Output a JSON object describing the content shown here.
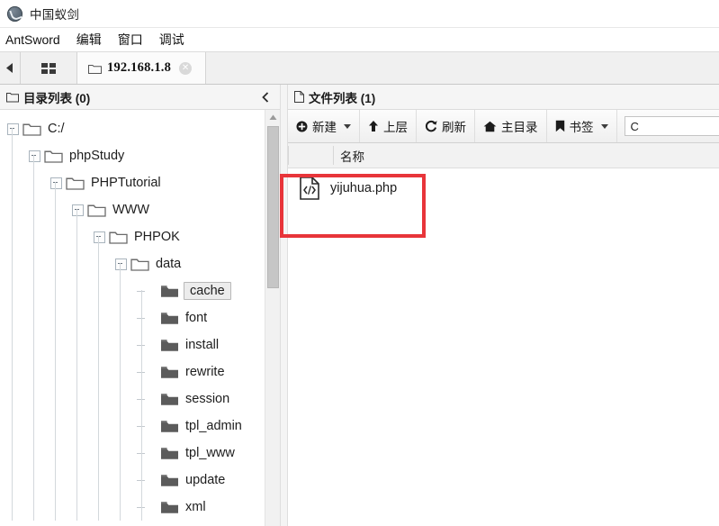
{
  "window": {
    "title": "中国蚁剑",
    "logo_icon": "antsword-logo-icon"
  },
  "menubar": {
    "items": [
      {
        "label": "AntSword"
      },
      {
        "label": "编辑"
      },
      {
        "label": "窗口"
      },
      {
        "label": "调试"
      }
    ]
  },
  "tabbar": {
    "nav_back_icon": "chevron-left-icon",
    "grid_icon": "grid-view-icon",
    "tabs": [
      {
        "label": "192.168.1.8",
        "icon": "folder-icon",
        "close_icon": "close-circle-icon",
        "active": true
      }
    ]
  },
  "left_panel": {
    "header": {
      "icon": "folder-outline-icon",
      "title": "目录列表 (0)",
      "collapse_icon": "chevron-left-icon"
    },
    "tree": [
      {
        "label": "C:/",
        "depth": 0,
        "expanded": true,
        "selected": false,
        "icon": "folder-open-icon"
      },
      {
        "label": "phpStudy",
        "depth": 1,
        "expanded": true,
        "selected": false,
        "icon": "folder-open-icon"
      },
      {
        "label": "PHPTutorial",
        "depth": 2,
        "expanded": true,
        "selected": false,
        "icon": "folder-open-icon"
      },
      {
        "label": "WWW",
        "depth": 3,
        "expanded": true,
        "selected": false,
        "icon": "folder-open-icon"
      },
      {
        "label": "PHPOK",
        "depth": 4,
        "expanded": true,
        "selected": false,
        "icon": "folder-open-icon"
      },
      {
        "label": "data",
        "depth": 5,
        "expanded": true,
        "selected": false,
        "icon": "folder-open-icon"
      },
      {
        "label": "cache",
        "depth": 6,
        "expanded": false,
        "selected": true,
        "icon": "folder-closed-icon"
      },
      {
        "label": "font",
        "depth": 6,
        "expanded": false,
        "selected": false,
        "icon": "folder-closed-icon"
      },
      {
        "label": "install",
        "depth": 6,
        "expanded": false,
        "selected": false,
        "icon": "folder-closed-icon"
      },
      {
        "label": "rewrite",
        "depth": 6,
        "expanded": false,
        "selected": false,
        "icon": "folder-closed-icon"
      },
      {
        "label": "session",
        "depth": 6,
        "expanded": false,
        "selected": false,
        "icon": "folder-closed-icon"
      },
      {
        "label": "tpl_admin",
        "depth": 6,
        "expanded": false,
        "selected": false,
        "icon": "folder-closed-icon"
      },
      {
        "label": "tpl_www",
        "depth": 6,
        "expanded": false,
        "selected": false,
        "icon": "folder-closed-icon"
      },
      {
        "label": "update",
        "depth": 6,
        "expanded": false,
        "selected": false,
        "icon": "folder-closed-icon"
      },
      {
        "label": "xml",
        "depth": 6,
        "expanded": false,
        "selected": false,
        "icon": "folder-closed-icon"
      }
    ],
    "scrollbar": {
      "up_arrow_icon": "triangle-up-icon"
    }
  },
  "right_panel": {
    "header": {
      "icon": "file-outline-icon",
      "title": "文件列表 (1)"
    },
    "toolbar": {
      "buttons": [
        {
          "label": "新建",
          "icon": "plus-circle-icon",
          "has_caret": true
        },
        {
          "label": "上层",
          "icon": "arrow-up-icon",
          "has_caret": false
        },
        {
          "label": "刷新",
          "icon": "refresh-icon",
          "has_caret": false
        },
        {
          "label": "主目录",
          "icon": "home-icon",
          "has_caret": false
        },
        {
          "label": "书签",
          "icon": "bookmark-icon",
          "has_caret": true
        }
      ],
      "search": {
        "value": "C",
        "placeholder": ""
      }
    },
    "columns": [
      {
        "label": "名称"
      }
    ],
    "files": [
      {
        "name": "yijuhua.php",
        "icon": "code-file-icon"
      }
    ]
  },
  "annotation": {
    "color": "#e8353a",
    "shape": "rectangle",
    "target": "yijuhua.php"
  }
}
